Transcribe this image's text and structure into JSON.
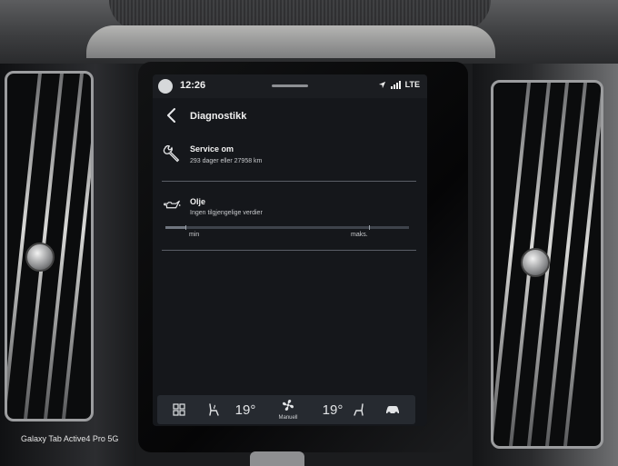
{
  "status_bar": {
    "time": "12:26",
    "network": "LTE",
    "icons": [
      "avatar-icon",
      "navigation-arrow-icon",
      "signal-bars-icon"
    ]
  },
  "header": {
    "title": "Diagnostikk",
    "back_icon": "chevron-left-icon"
  },
  "items": [
    {
      "icon": "wrench-icon",
      "title": "Service om",
      "subtitle": "293 dager eller 27958 km"
    },
    {
      "icon": "oil-can-icon",
      "title": "Olje",
      "subtitle": "Ingen tilgjengelige verdier",
      "scale": {
        "min_label": "min",
        "max_label": "maks."
      }
    }
  ],
  "climate_bar": {
    "left_temp": "19°",
    "right_temp": "19°",
    "fan_mode": "Manuell",
    "icons": [
      "grid-icon",
      "seat-heat-left-icon",
      "fan-icon",
      "seat-heat-right-icon",
      "car-defrost-icon"
    ]
  },
  "device_watermark": "Galaxy Tab Active4 Pro 5G",
  "colors": {
    "screen_bg": "#15171b",
    "text": "#f2f2f2",
    "bar_bg": "#262a30"
  }
}
